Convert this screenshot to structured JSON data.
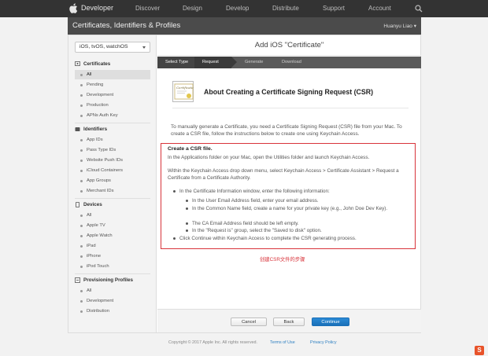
{
  "topnav": {
    "brand": "Developer",
    "items": [
      "Discover",
      "Design",
      "Develop",
      "Distribute",
      "Support",
      "Account"
    ]
  },
  "subheader": {
    "title": "Certificates, Identifiers & Profiles",
    "user": "Huanyu Liao ▾"
  },
  "sidebar": {
    "platform": "iOS, tvOS, watchOS",
    "sections": [
      {
        "title": "Certificates",
        "icon": "certificate-icon",
        "items": [
          "All",
          "Pending",
          "Development",
          "Production",
          "APNs Auth Key"
        ]
      },
      {
        "title": "Identifiers",
        "icon": "identifier-icon",
        "items": [
          "App IDs",
          "Pass Type IDs",
          "Website Push IDs",
          "iCloud Containers",
          "App Groups",
          "Merchant IDs"
        ]
      },
      {
        "title": "Devices",
        "icon": "device-icon",
        "items": [
          "All",
          "Apple TV",
          "Apple Watch",
          "iPad",
          "iPhone",
          "iPod Touch"
        ]
      },
      {
        "title": "Provisioning Profiles",
        "icon": "profile-icon",
        "items": [
          "All",
          "Development",
          "Distribution"
        ]
      }
    ]
  },
  "main": {
    "title": "Add iOS \"Certificate\"",
    "steps": [
      "Select Type",
      "Request",
      "Generate",
      "Download"
    ],
    "icon_text": "Certificate",
    "heading": "About Creating a Certificate Signing Request (CSR)",
    "intro": "To manually generate a Certificate, you need a Certificate Signing Request (CSR) file from your Mac. To create a CSR file, follow the instructions below to create one using Keychain Access.",
    "box": {
      "head": "Create a CSR file.",
      "p1": "In the Applications folder on your Mac, open the Utilities folder and launch Keychain Access.",
      "p2": "Within the Keychain Access drop down menu, select Keychain Access > Certificate Assistant > Request a Certificate from a Certificate Authority.",
      "bullet1": "In the Certificate Information window, enter the following information:",
      "sub1": "In the User Email Address field, enter your email address.",
      "sub2": "In the Common Name field, create a name for your private key (e.g., John Doe Dev Key).",
      "sub3": "The CA Email Address field should be left empty.",
      "sub4": "In the \"Request is\" group, select the \"Saved to disk\" option.",
      "bullet2": "Click Continue within Keychain Access to complete the CSR generating process."
    },
    "annotation": "创建CSR文件的步骤",
    "buttons": {
      "cancel": "Cancel",
      "back": "Back",
      "continue": "Continue"
    }
  },
  "footer": {
    "copyright": "Copyright © 2017 Apple Inc. All rights reserved.",
    "terms": "Terms of Use",
    "privacy": "Privacy Policy"
  },
  "corner_logo": "S"
}
